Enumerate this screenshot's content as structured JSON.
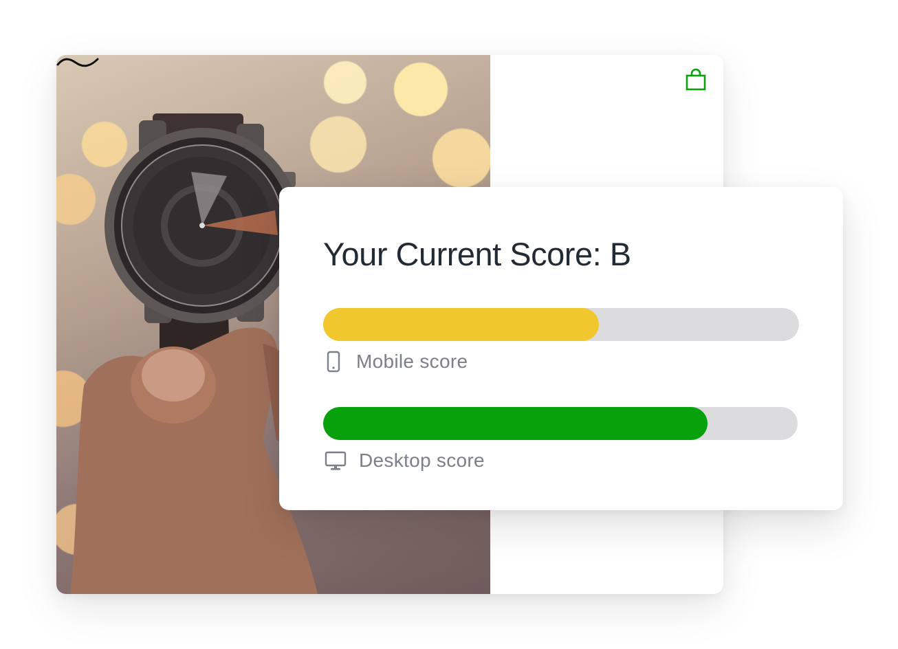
{
  "header": {
    "logo_icon": "tilde-wave-logo-icon",
    "cart_icon": "shopping-bag-icon"
  },
  "hero": {
    "image": "hand-holding-wristwatch-photo"
  },
  "score_card": {
    "title": "Your Current Score: B",
    "metrics": [
      {
        "label": "Mobile score",
        "icon": "smartphone-icon",
        "fill_fraction": 0.58,
        "color": "#f0c82e"
      },
      {
        "label": "Desktop score",
        "icon": "desktop-monitor-icon",
        "fill_fraction": 0.81,
        "color": "#06a10b"
      }
    ]
  },
  "colors": {
    "accent_green": "#06a10b",
    "accent_yellow": "#f0c82e",
    "track": "#dcdcde",
    "title_text": "#222a33",
    "label_text": "#7b7f87"
  }
}
